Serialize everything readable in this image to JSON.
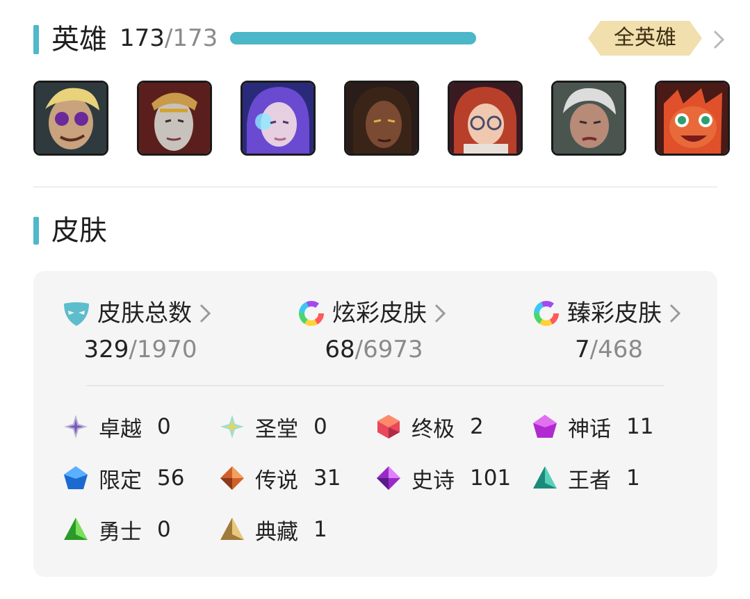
{
  "heroes": {
    "title": "英雄",
    "owned": "173",
    "separator": "/",
    "total": "173",
    "progress": 1.0,
    "all_button": "全英雄",
    "avatars": [
      "hero-1",
      "hero-2",
      "hero-3",
      "hero-4",
      "hero-5",
      "hero-6",
      "hero-7"
    ]
  },
  "skins": {
    "title": "皮肤",
    "stats": [
      {
        "label": "皮肤总数",
        "owned": "329",
        "total": "1970",
        "icon": "mask-icon"
      },
      {
        "label": "炫彩皮肤",
        "owned": "68",
        "total": "6973",
        "icon": "color-ring-icon"
      },
      {
        "label": "臻彩皮肤",
        "owned": "7",
        "total": "468",
        "icon": "color-ring-icon"
      }
    ],
    "separator": "/",
    "tiers": [
      {
        "label": "卓越",
        "value": "0",
        "icon": "transcendent-gem-icon"
      },
      {
        "label": "圣堂",
        "value": "0",
        "icon": "exalted-gem-icon"
      },
      {
        "label": "终极",
        "value": "2",
        "icon": "ultimate-gem-icon"
      },
      {
        "label": "神话",
        "value": "11",
        "icon": "mythic-gem-icon"
      },
      {
        "label": "限定",
        "value": "56",
        "icon": "limited-gem-icon"
      },
      {
        "label": "传说",
        "value": "31",
        "icon": "legendary-gem-icon"
      },
      {
        "label": "史诗",
        "value": "101",
        "icon": "epic-gem-icon"
      },
      {
        "label": "王者",
        "value": "1",
        "icon": "champion-gem-icon"
      },
      {
        "label": "勇士",
        "value": "0",
        "icon": "warrior-gem-icon"
      },
      {
        "label": "典藏",
        "value": "1",
        "icon": "collection-gem-icon"
      }
    ]
  },
  "colors": {
    "accent": "#4bb7c8",
    "badge_gold": "#f1dfae"
  }
}
